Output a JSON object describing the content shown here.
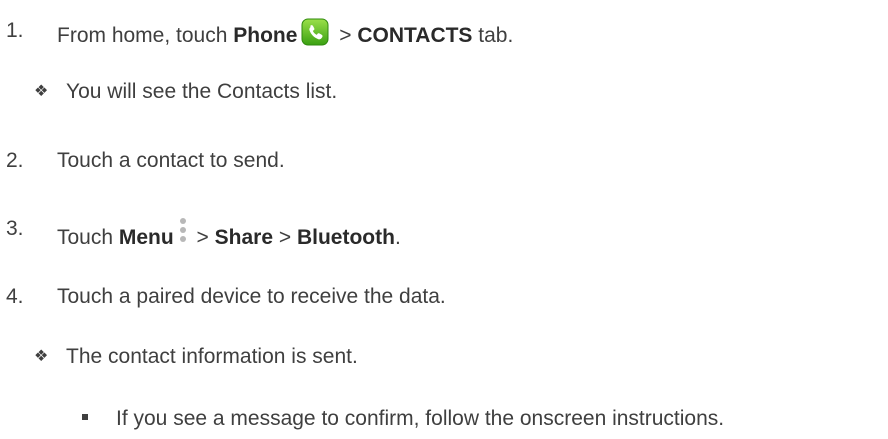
{
  "steps": [
    {
      "number": "1.",
      "pre": "From home, touch ",
      "bold1": "Phone",
      "icon": "phone-icon",
      "sep": " > ",
      "bold2": "CONTACTS",
      "post": " tab."
    },
    {
      "bullet": "❖",
      "text": "You will see the Contacts list."
    },
    {
      "number": "2.",
      "text": "Touch a contact to send."
    },
    {
      "number": "3.",
      "pre": "Touch ",
      "bold1": "Menu",
      "icon": "menu-dots-icon",
      "sep1": " > ",
      "bold2": "Share",
      "sep2": " > ",
      "bold3": "Bluetooth",
      "post": "."
    },
    {
      "number": "4.",
      "text": "Touch a paired device to receive the data."
    },
    {
      "bullet": "❖",
      "text": "The contact information is sent."
    },
    {
      "text": "If you see a message to confirm, follow the onscreen instructions."
    }
  ],
  "colors": {
    "text": "#3f3f3f",
    "phone_icon_green": "#5fc21f"
  }
}
